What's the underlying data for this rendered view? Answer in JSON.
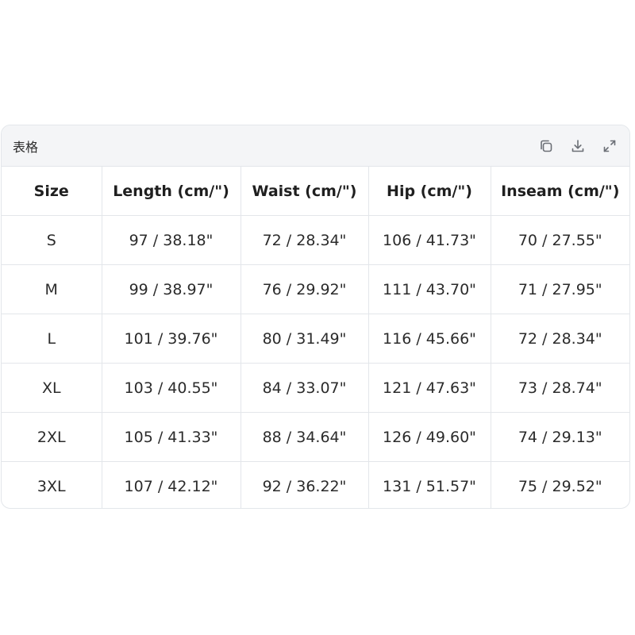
{
  "card": {
    "title": "表格",
    "actions": {
      "copy_icon": "copy-icon",
      "download_icon": "download-icon",
      "expand_icon": "expand-icon"
    }
  },
  "table": {
    "headers": [
      "Size",
      "Length (cm/\")",
      "Waist (cm/\")",
      "Hip (cm/\")",
      "Inseam (cm/\")"
    ],
    "rows": [
      [
        "S",
        "97 / 38.18\"",
        "72 / 28.34\"",
        "106 / 41.73\"",
        "70 / 27.55\""
      ],
      [
        "M",
        "99 / 38.97\"",
        "76 / 29.92\"",
        "111 / 43.70\"",
        "71 / 27.95\""
      ],
      [
        "L",
        "101 / 39.76\"",
        "80 / 31.49\"",
        "116 / 45.66\"",
        "72 / 28.34\""
      ],
      [
        "XL",
        "103 / 40.55\"",
        "84 / 33.07\"",
        "121 / 47.63\"",
        "73 / 28.74\""
      ],
      [
        "2XL",
        "105 / 41.33\"",
        "88 / 34.64\"",
        "126 / 49.60\"",
        "74 / 29.13\""
      ],
      [
        "3XL",
        "107 / 42.12\"",
        "92 / 36.22\"",
        "131 / 51.57\"",
        "75 / 29.52\""
      ]
    ]
  },
  "colors": {
    "header_bg": "#f4f5f7",
    "border": "#e3e6ea",
    "text": "#2b2b2b",
    "icon": "#6b6f76"
  }
}
